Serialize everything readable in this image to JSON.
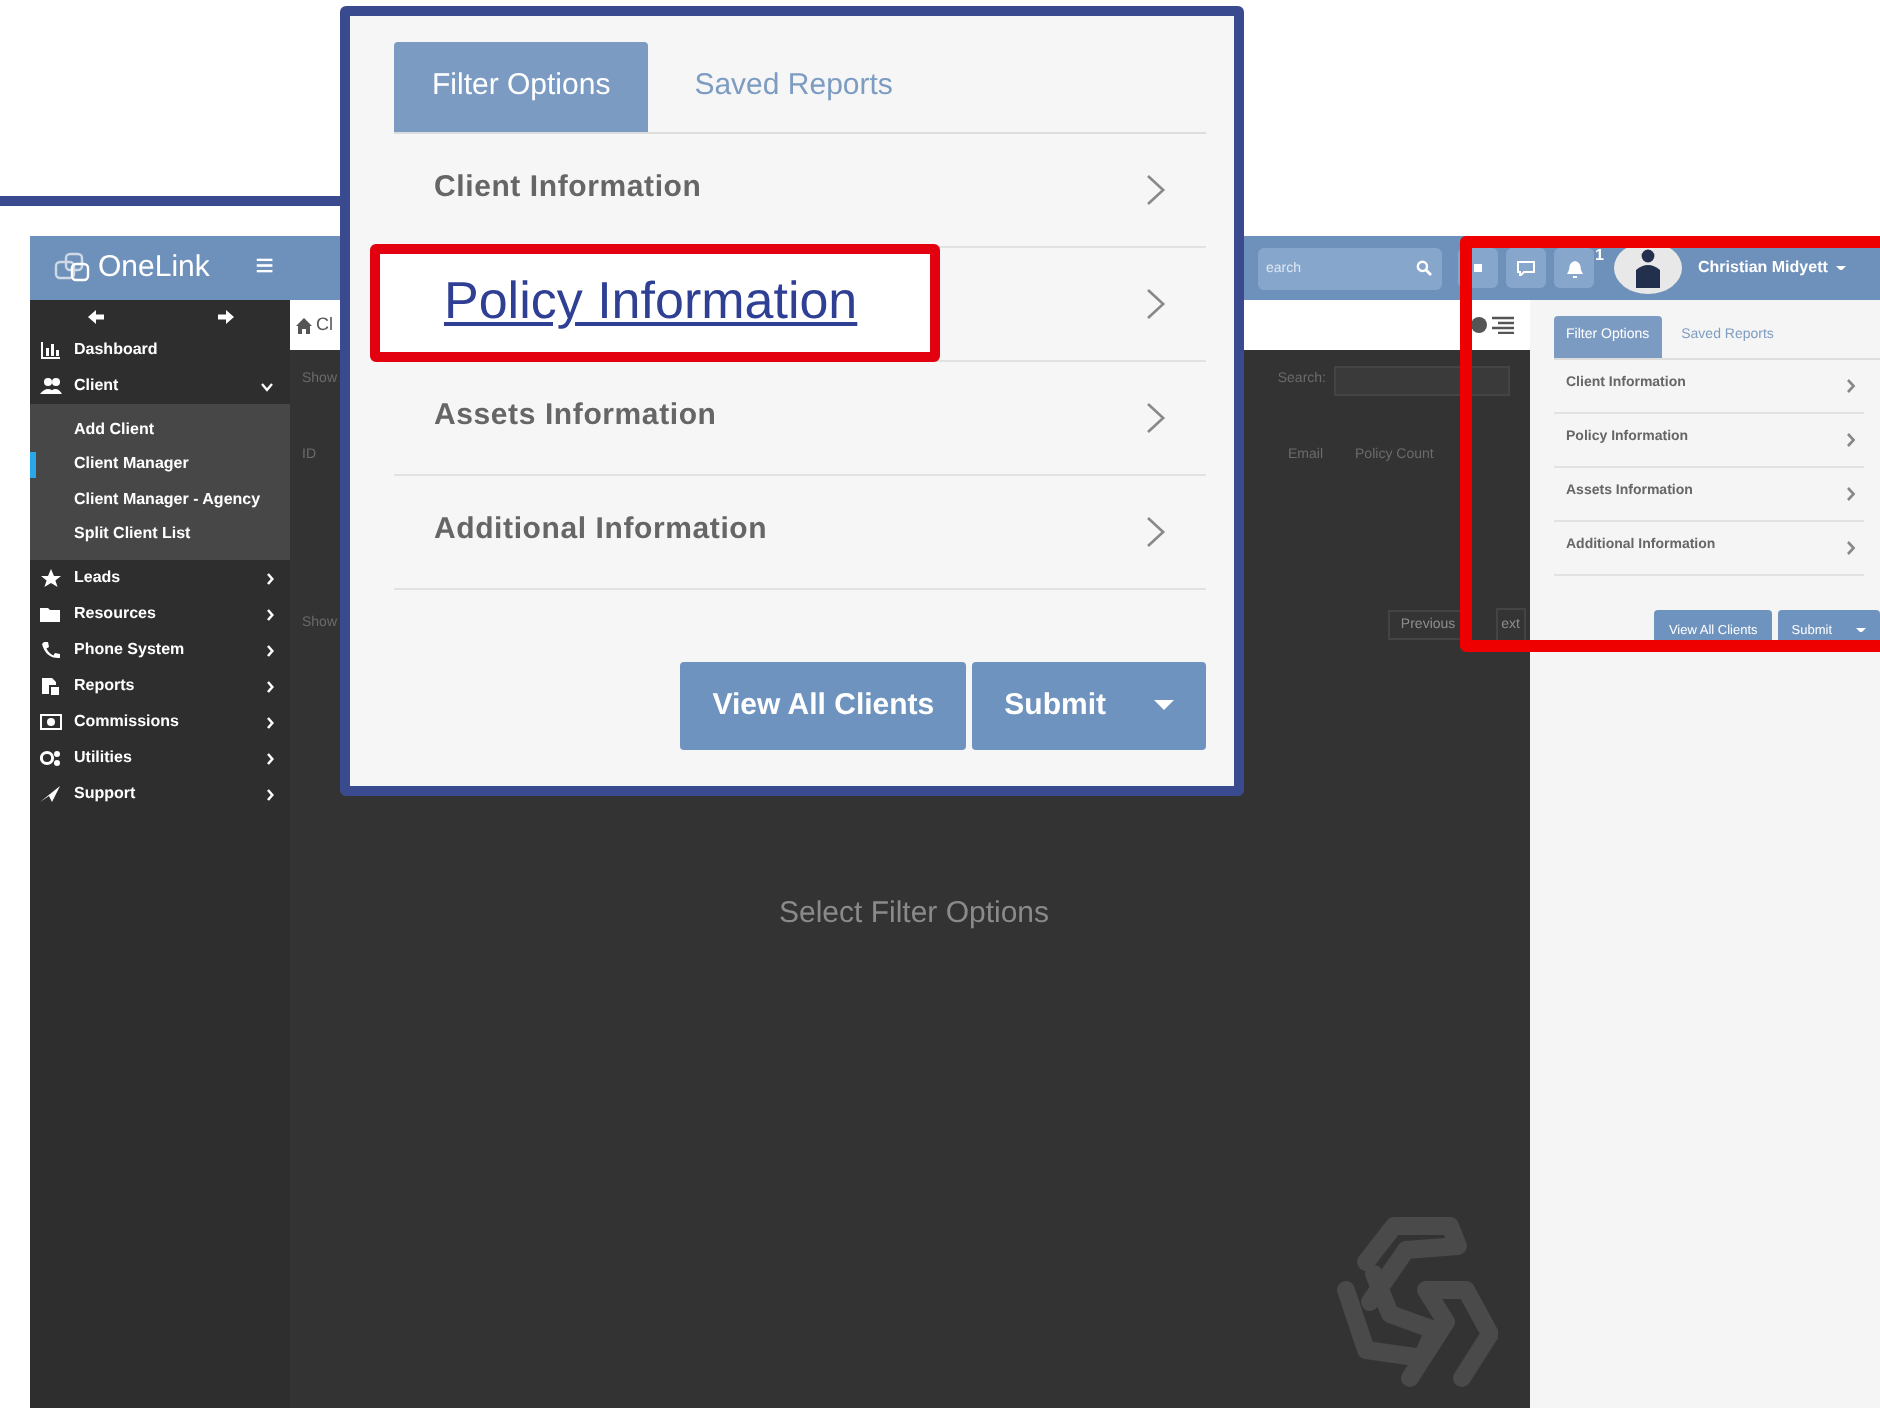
{
  "callout": {
    "tabs": [
      {
        "label": "Filter Options",
        "selected": true
      },
      {
        "label": "Saved Reports",
        "selected": false
      }
    ],
    "items": [
      {
        "label": "Client Information",
        "highlighted": false
      },
      {
        "label": "Policy Information",
        "highlighted": true
      },
      {
        "label": "Assets Information",
        "highlighted": false
      },
      {
        "label": "Additional Information",
        "highlighted": false
      }
    ],
    "buttons": [
      "View All Clients",
      "Submit"
    ]
  },
  "sidebar": {
    "logo": "OneLink",
    "menu_glyph": "≡",
    "items": [
      {
        "label": "Dashboard"
      },
      {
        "label": "Client",
        "expanded": true,
        "children": [
          {
            "label": "Add Client",
            "selected": false
          },
          {
            "label": "Client Manager",
            "selected": true
          },
          {
            "label": "Client Manager - Agency",
            "selected": false
          },
          {
            "label": "Split Client List",
            "selected": false
          }
        ]
      },
      {
        "label": "Leads",
        "expanded": false
      },
      {
        "label": "Resources",
        "expanded": false
      },
      {
        "label": "Phone System",
        "expanded": false
      },
      {
        "label": "Reports",
        "expanded": false
      },
      {
        "label": "Commissions",
        "expanded": false
      },
      {
        "label": "Utilities",
        "expanded": false
      },
      {
        "label": "Support",
        "expanded": false
      }
    ]
  },
  "topbar": {
    "search": {
      "placeholder": "earch"
    },
    "notification_count": "1",
    "user_name": "Christian Midyett"
  },
  "breadcrumb": "Cl",
  "content": {
    "length_label": "Show",
    "search_label": "Search:",
    "columns": [
      "ID",
      "Email",
      "Policy Count"
    ],
    "info_label": "Show",
    "pager": [
      "Previous",
      "ext"
    ],
    "empty_message": "Select Filter Options"
  },
  "filter_panel": {
    "tabs": [
      {
        "label": "Filter Options",
        "selected": true
      },
      {
        "label": "Saved Reports",
        "selected": false
      }
    ],
    "items": [
      "Client Information",
      "Policy Information",
      "Assets Information",
      "Additional Information"
    ],
    "buttons": [
      "View All Clients",
      "Submit"
    ]
  }
}
